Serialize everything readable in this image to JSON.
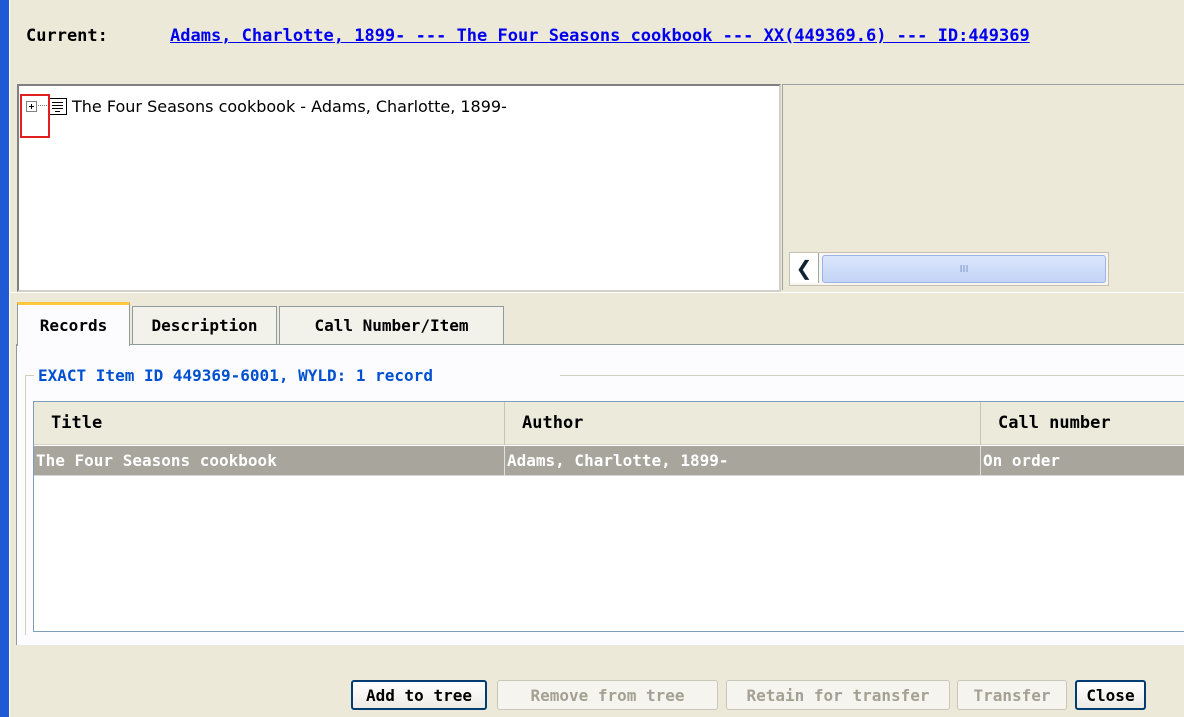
{
  "current": {
    "label": "Current:",
    "link_text": "Adams, Charlotte, 1899- --- The Four Seasons cookbook --- XX(449369.6) --- ID:449369"
  },
  "tree": {
    "node_label": "The Four Seasons cookbook - Adams, Charlotte, 1899-",
    "expander_icon": "plus-expander-icon",
    "node_icon": "record-icon"
  },
  "detail": {
    "scroll_grip": "III"
  },
  "tabs": [
    {
      "label": "Records",
      "active": true
    },
    {
      "label": "Description",
      "active": false
    },
    {
      "label": "Call Number/Item",
      "active": false
    }
  ],
  "records": {
    "group_title": "EXACT Item ID 449369-6001, WYLD: 1 record",
    "columns": [
      "Title",
      "Author",
      "Call number"
    ],
    "rows": [
      {
        "title": "The Four Seasons cookbook",
        "author": "Adams, Charlotte, 1899-",
        "call_number": "On order",
        "selected": true
      }
    ]
  },
  "buttons": {
    "add_to_tree": "Add to tree",
    "remove_from_tree": "Remove from tree",
    "retain_for_transfer": "Retain for transfer",
    "transfer": "Transfer",
    "close": "Close"
  },
  "colors": {
    "link": "#0000ee",
    "group_title": "#0050d0",
    "selected_row": "#a8a59c",
    "active_tab_accent": "#ffc83c",
    "highlight_box": "#e02020"
  }
}
